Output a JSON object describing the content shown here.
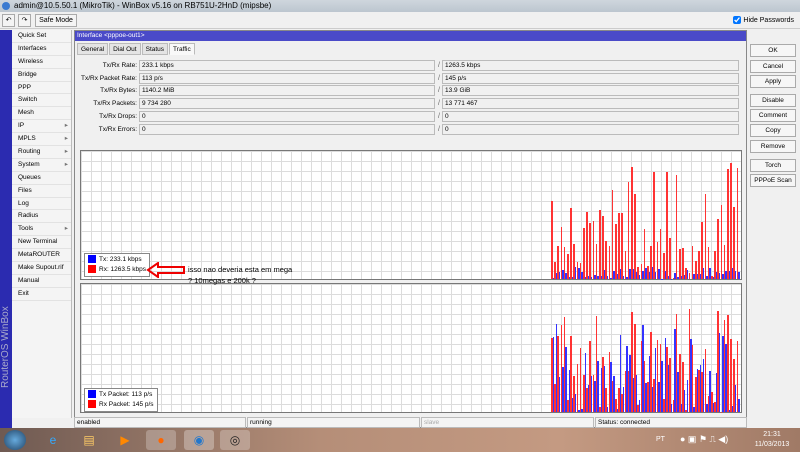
{
  "window": {
    "title": "admin@10.5.50.1 (MikroTik) - WinBox v5.16 on RB751U-2HnD (mipsbe)"
  },
  "toolbar": {
    "undo": "undo",
    "redo": "redo",
    "safe_mode": "Safe Mode",
    "hide_passwords": "Hide Passwords",
    "hide_passwords_checked": true
  },
  "sidebar": {
    "brand": "RouterOS WinBox",
    "items": [
      {
        "label": "Quick Set"
      },
      {
        "label": "Interfaces"
      },
      {
        "label": "Wireless"
      },
      {
        "label": "Bridge"
      },
      {
        "label": "PPP"
      },
      {
        "label": "Switch"
      },
      {
        "label": "Mesh"
      },
      {
        "label": "IP",
        "sub": true
      },
      {
        "label": "MPLS",
        "sub": true
      },
      {
        "label": "Routing",
        "sub": true
      },
      {
        "label": "System",
        "sub": true
      },
      {
        "label": "Queues"
      },
      {
        "label": "Files"
      },
      {
        "label": "Log"
      },
      {
        "label": "Radius"
      },
      {
        "label": "Tools",
        "sub": true
      },
      {
        "label": "New Terminal"
      },
      {
        "label": "MetaROUTER"
      },
      {
        "label": "Make Supout.rif"
      },
      {
        "label": "Manual"
      },
      {
        "label": "Exit"
      }
    ]
  },
  "dialog": {
    "title": "Interface <pppoe-out1>",
    "tabs": [
      "General",
      "Dial Out",
      "Status",
      "Traffic"
    ],
    "active_tab": "Traffic",
    "fields": [
      {
        "label": "Tx/Rx Rate:",
        "tx": "233.1 kbps",
        "rx": "1263.5 kbps"
      },
      {
        "label": "Tx/Rx Packet Rate:",
        "tx": "113 p/s",
        "rx": "145 p/s"
      },
      {
        "label": "Tx/Rx Bytes:",
        "tx": "1140.2 MiB",
        "rx": "13.9 GiB"
      },
      {
        "label": "Tx/Rx Packets:",
        "tx": "9 734 280",
        "rx": "13 771 467"
      },
      {
        "label": "Tx/Rx Drops:",
        "tx": "0",
        "rx": "0"
      },
      {
        "label": "Tx/Rx Errors:",
        "tx": "0",
        "rx": "0"
      }
    ],
    "graph1_legend": {
      "tx": "Tx:  233.1 kbps",
      "rx": "Rx:  1263.5 kbps"
    },
    "graph2_legend": {
      "tx": "Tx Packet:  113 p/s",
      "rx": "Rx Packet:  145 p/s"
    },
    "buttons": [
      "OK",
      "Cancel",
      "Apply",
      "Disable",
      "Comment",
      "Copy",
      "Remove",
      "Torch",
      "PPPoE Scan"
    ],
    "status": [
      "enabled",
      "running",
      "slave",
      "Status: connected"
    ]
  },
  "annotation": "isso nao deveria esta em mega ? 10megas e 200k ?",
  "colors": {
    "tx": "#0000ff",
    "rx": "#ff0000",
    "title": "#4a4ac8"
  },
  "taskbar": {
    "lang": "PT",
    "time": "21:31",
    "date": "11/03/2013"
  }
}
